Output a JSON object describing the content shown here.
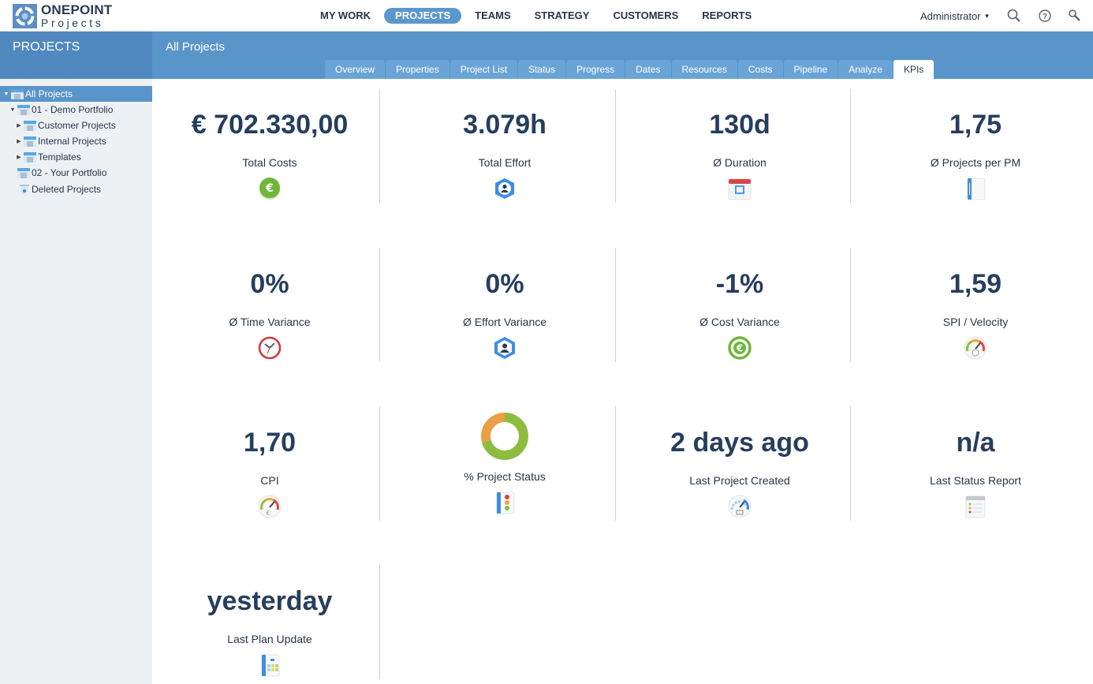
{
  "app": {
    "logo_line1": "ONEPOINT",
    "logo_line2": "Projects"
  },
  "nav": {
    "items": [
      {
        "label": "MY WORK",
        "active": false
      },
      {
        "label": "PROJECTS",
        "active": true
      },
      {
        "label": "TEAMS",
        "active": false
      },
      {
        "label": "STRATEGY",
        "active": false
      },
      {
        "label": "CUSTOMERS",
        "active": false
      },
      {
        "label": "REPORTS",
        "active": false
      }
    ],
    "user": "Administrator",
    "icons": [
      "search-icon",
      "help-icon",
      "tools-icon"
    ]
  },
  "sidebar": {
    "title": "PROJECTS",
    "tree": [
      {
        "label": "All Projects",
        "level": 0,
        "arrow": "expanded",
        "icon": "folder-icon",
        "selected": true
      },
      {
        "label": "01 - Demo Portfolio",
        "level": 1,
        "arrow": "expanded",
        "icon": "folder-icon",
        "selected": false
      },
      {
        "label": "Customer Projects",
        "level": 2,
        "arrow": "collapsed",
        "icon": "folder-icon",
        "selected": false
      },
      {
        "label": "Internal Projects",
        "level": 2,
        "arrow": "collapsed",
        "icon": "folder-icon",
        "selected": false
      },
      {
        "label": "Templates",
        "level": 2,
        "arrow": "collapsed",
        "icon": "folder-icon",
        "selected": false
      },
      {
        "label": "02 - Your Portfolio",
        "level": 1,
        "arrow": "none",
        "icon": "folder-icon",
        "selected": false
      },
      {
        "label": "Deleted Projects",
        "level": 1,
        "arrow": "none",
        "icon": "trash-icon",
        "selected": false
      }
    ]
  },
  "main": {
    "title": "All Projects",
    "tabs": [
      {
        "label": "Overview",
        "active": false
      },
      {
        "label": "Properties",
        "active": false
      },
      {
        "label": "Project List",
        "active": false
      },
      {
        "label": "Status",
        "active": false
      },
      {
        "label": "Progress",
        "active": false
      },
      {
        "label": "Dates",
        "active": false
      },
      {
        "label": "Resources",
        "active": false
      },
      {
        "label": "Costs",
        "active": false
      },
      {
        "label": "Pipeline",
        "active": false
      },
      {
        "label": "Analyze",
        "active": false
      },
      {
        "label": "KPIs",
        "active": true
      }
    ],
    "kpis": [
      {
        "value": "€ 702.330,00",
        "label": "Total Costs",
        "icon": "euro-coin-icon"
      },
      {
        "value": "3.079h",
        "label": "Total Effort",
        "icon": "person-hexagon-icon"
      },
      {
        "value": "130d",
        "label": "Ø Duration",
        "icon": "calendar-icon"
      },
      {
        "value": "1,75",
        "label": "Ø Projects per PM",
        "icon": "binder-icon"
      },
      {
        "value": "0%",
        "label": "Ø Time Variance",
        "icon": "clock-icon"
      },
      {
        "value": "0%",
        "label": "Ø Effort Variance",
        "icon": "person-hexagon-icon"
      },
      {
        "value": "-1%",
        "label": "Ø Cost Variance",
        "icon": "euro-ring-icon"
      },
      {
        "value": "1,59",
        "label": "SPI / Velocity",
        "icon": "gauge-clock-icon"
      },
      {
        "value": "1,70",
        "label": "CPI",
        "icon": "gauge-euro-icon"
      },
      {
        "value": "",
        "label": "% Project Status",
        "icon": "traffic-light-binder-icon",
        "donut": [
          {
            "name": "orange",
            "percent": 29,
            "color": "#eb9e45"
          },
          {
            "name": "green",
            "percent": 71,
            "color": "#8cbd3f"
          }
        ]
      },
      {
        "value": "2 days ago",
        "label": "Last Project Created",
        "icon": "gauge-monitor-icon"
      },
      {
        "value": "n/a",
        "label": "Last Status Report",
        "icon": "status-report-icon"
      },
      {
        "value": "yesterday",
        "label": "Last Plan Update",
        "icon": "plan-binder-icon"
      }
    ]
  },
  "colors": {
    "brand_blue": "#5a95ca",
    "sidebar_band": "#4f89bf",
    "kpi_text": "#263e5e",
    "green": "#8cbd3f",
    "orange": "#eb9e45"
  }
}
